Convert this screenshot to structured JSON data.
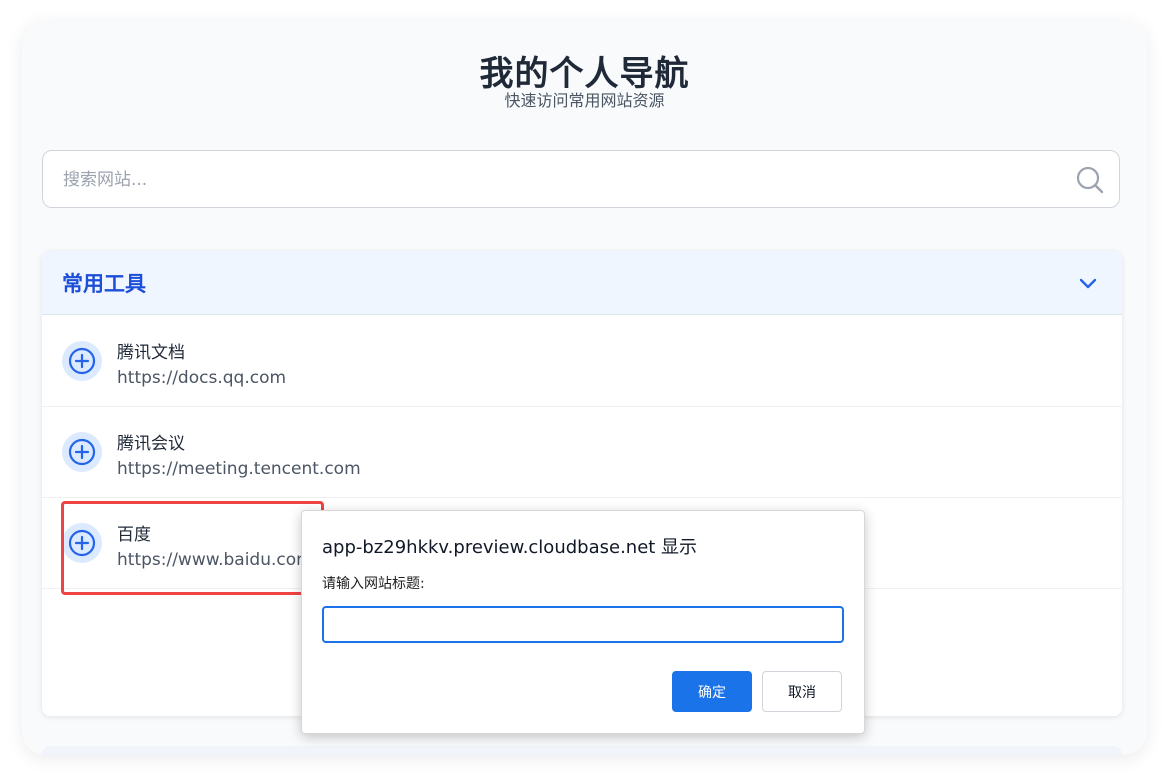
{
  "header": {
    "title": "我的个人导航",
    "subtitle": "快速访问常用网站资源"
  },
  "search": {
    "placeholder": "搜索网站...",
    "icon": "search-icon"
  },
  "section": {
    "title": "常用工具",
    "icon": "chevron-down-icon",
    "items": [
      {
        "name": "腾讯文档",
        "url": "https://docs.qq.com",
        "icon": "plus-circle-icon"
      },
      {
        "name": "腾讯会议",
        "url": "https://meeting.tencent.com",
        "icon": "plus-circle-icon"
      },
      {
        "name": "百度",
        "url": "https://www.baidu.com",
        "icon": "plus-circle-icon"
      }
    ]
  },
  "dialog": {
    "title": "app-bz29hkkv.preview.cloudbase.net 显示",
    "message": "请输入网站标题:",
    "input_value": "",
    "ok_label": "确定",
    "cancel_label": "取消"
  },
  "colors": {
    "accent": "#1a73e8",
    "section_title": "#1d4ed8",
    "highlight": "#ef4444"
  }
}
